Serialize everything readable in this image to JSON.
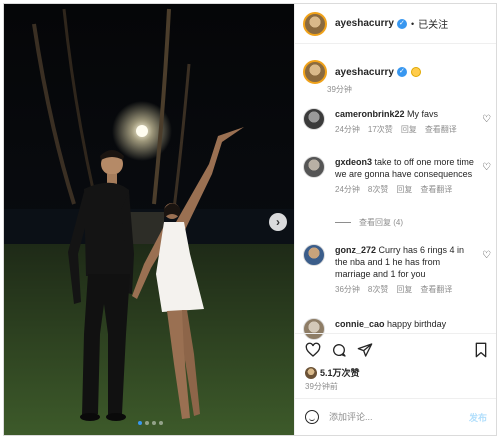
{
  "post": {
    "author": "ayeshacurry",
    "follow_label": "已关注",
    "separator": "•",
    "caption_time": "39分钟"
  },
  "comments": [
    {
      "user": "cameronbrink22",
      "text": "My favs",
      "time": "24分钟",
      "likes": "17次赞",
      "reply": "回复",
      "translate": "查看翻译"
    },
    {
      "user": "gxdeon3",
      "text": "take to off one more time we are gonna have consequences",
      "time": "24分钟",
      "likes": "8次赞",
      "reply": "回复",
      "translate": "查看翻译",
      "view_replies": "查看回复 (4)"
    },
    {
      "user": "gonz_272",
      "text": "Curry has 6 rings 4 in the nba and 1 he has from marriage and 1 for you",
      "time": "36分钟",
      "likes": "8次赞",
      "reply": "回复",
      "translate": "查看翻译"
    },
    {
      "user": "connie_cao",
      "text": "happy birthday"
    }
  ],
  "footer": {
    "likes": "5.1万次赞",
    "ago": "39分钟前",
    "comment_placeholder": "添加评论...",
    "post_label": "发布"
  },
  "colors": {
    "link": "#3897f0",
    "muted": "#8e8e8e",
    "ring": "#f0a21a"
  },
  "icons": [
    "heart-icon",
    "comment-icon",
    "share-icon",
    "bookmark-icon",
    "emoji-icon",
    "verified-icon",
    "next-arrow-icon"
  ]
}
